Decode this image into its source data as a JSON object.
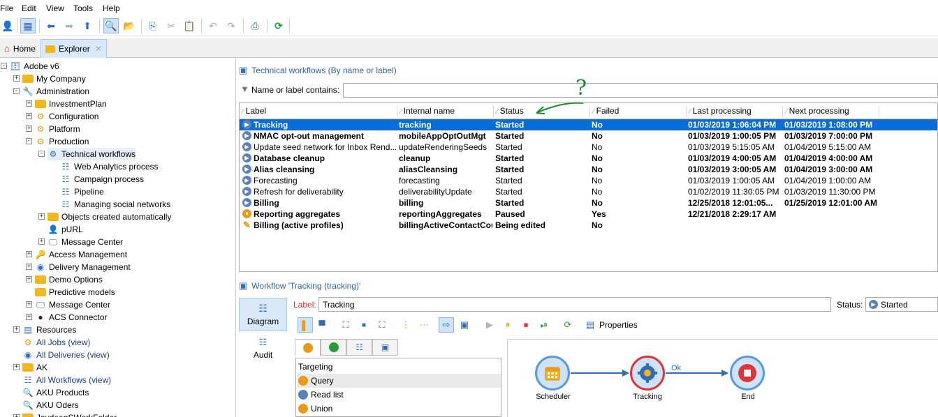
{
  "menu": [
    "File",
    "Edit",
    "View",
    "Tools",
    "Help"
  ],
  "tabs": [
    {
      "label": "Home"
    },
    {
      "label": "Explorer"
    }
  ],
  "tree": [
    {
      "label": "Adobe v6",
      "level": 0,
      "exp": "-",
      "icon": "database",
      "link": false
    },
    {
      "label": "My Company",
      "level": 1,
      "exp": "+",
      "icon": "folder",
      "link": false
    },
    {
      "label": "Administration",
      "level": 1,
      "exp": "-",
      "icon": "wrench",
      "link": false
    },
    {
      "label": "InvestmentPlan",
      "level": 2,
      "exp": "+",
      "icon": "folder",
      "link": false
    },
    {
      "label": "Configuration",
      "level": 2,
      "exp": "+",
      "icon": "gear",
      "link": false
    },
    {
      "label": "Platform",
      "level": 2,
      "exp": "+",
      "icon": "gear",
      "link": false
    },
    {
      "label": "Production",
      "level": 2,
      "exp": "-",
      "icon": "gear",
      "link": false
    },
    {
      "label": "Technical workflows",
      "level": 3,
      "exp": "-",
      "icon": "wf-folder",
      "link": false,
      "hl": true
    },
    {
      "label": "Web Analytics process",
      "level": 4,
      "exp": "",
      "icon": "workflow",
      "link": false
    },
    {
      "label": "Campaign process",
      "level": 4,
      "exp": "",
      "icon": "workflow",
      "link": false
    },
    {
      "label": "Pipeline",
      "level": 4,
      "exp": "",
      "icon": "workflow",
      "link": false
    },
    {
      "label": "Managing social networks",
      "level": 4,
      "exp": "",
      "icon": "workflow",
      "link": false
    },
    {
      "label": "Objects created automatically",
      "level": 3,
      "exp": "+",
      "icon": "folder",
      "link": false
    },
    {
      "label": "pURL",
      "level": 3,
      "exp": "",
      "icon": "purl",
      "link": false
    },
    {
      "label": "Message Center",
      "level": 3,
      "exp": "+",
      "icon": "monitor",
      "link": false
    },
    {
      "label": "Access Management",
      "level": 2,
      "exp": "+",
      "icon": "access",
      "link": false
    },
    {
      "label": "Delivery Management",
      "level": 2,
      "exp": "+",
      "icon": "delivery",
      "link": false
    },
    {
      "label": "Demo Options",
      "level": 2,
      "exp": "+",
      "icon": "folder",
      "link": false
    },
    {
      "label": "Predictive models",
      "level": 2,
      "exp": "",
      "icon": "folder",
      "link": false
    },
    {
      "label": "Message Center",
      "level": 2,
      "exp": "+",
      "icon": "monitor",
      "link": false
    },
    {
      "label": "ACS Connector",
      "level": 2,
      "exp": "+",
      "icon": "acs",
      "link": false
    },
    {
      "label": "Resources",
      "level": 1,
      "exp": "+",
      "icon": "resources",
      "link": false
    },
    {
      "label": "All Jobs (view)",
      "level": 1,
      "exp": "",
      "icon": "gear",
      "link": true
    },
    {
      "label": "All Deliveries (view)",
      "level": 1,
      "exp": "",
      "icon": "delivery",
      "link": true
    },
    {
      "label": "AK",
      "level": 1,
      "exp": "+",
      "icon": "folder",
      "link": false
    },
    {
      "label": "All Workflows (view)",
      "level": 1,
      "exp": "",
      "icon": "workflow",
      "link": true
    },
    {
      "label": "AKU Products",
      "level": 1,
      "exp": "",
      "icon": "search",
      "link": false
    },
    {
      "label": "AKU Oders",
      "level": 1,
      "exp": "",
      "icon": "search",
      "link": false
    },
    {
      "label": "JaydeepSWorkFolder",
      "level": 1,
      "exp": "+",
      "icon": "folder",
      "link": false
    }
  ],
  "list": {
    "title": "Technical workflows (By name or label)",
    "filter_label": "Name or label contains:",
    "filter_value": "",
    "columns": [
      "Label",
      "Internal name",
      "Status",
      "Failed",
      "Last processing",
      "Next processing"
    ],
    "rows": [
      {
        "label": "Tracking",
        "name": "tracking",
        "status": "Started",
        "failed": "No",
        "last": "01/03/2019 1:06:04 PM",
        "next": "01/03/2019 1:08:00 PM",
        "bold": true,
        "selected": true,
        "icon": "play"
      },
      {
        "label": "NMAC opt-out management",
        "name": "mobileAppOptOutMgt",
        "status": "Started",
        "failed": "No",
        "last": "01/03/2019 1:00:05 PM",
        "next": "01/03/2019 7:00:00 PM",
        "bold": true,
        "selected": false,
        "icon": "play"
      },
      {
        "label": "Update seed network for Inbox Rend...",
        "name": "updateRenderingSeeds",
        "status": "Started",
        "failed": "No",
        "last": "01/03/2019 5:15:05 AM",
        "next": "01/04/2019 5:15:00 AM",
        "bold": false,
        "selected": false,
        "icon": "play"
      },
      {
        "label": "Database cleanup",
        "name": "cleanup",
        "status": "Started",
        "failed": "No",
        "last": "01/03/2019 4:00:05 AM",
        "next": "01/04/2019 4:00:00 AM",
        "bold": true,
        "selected": false,
        "icon": "play"
      },
      {
        "label": "Alias cleansing",
        "name": "aliasCleansing",
        "status": "Started",
        "failed": "No",
        "last": "01/03/2019 3:00:05 AM",
        "next": "01/04/2019 3:00:00 AM",
        "bold": true,
        "selected": false,
        "icon": "play"
      },
      {
        "label": "Forecasting",
        "name": "forecasting",
        "status": "Started",
        "failed": "No",
        "last": "01/03/2019 1:00:05 AM",
        "next": "01/04/2019 1:00:00 AM",
        "bold": false,
        "selected": false,
        "icon": "play"
      },
      {
        "label": "Refresh for deliverability",
        "name": "deliverabilityUpdate",
        "status": "Started",
        "failed": "No",
        "last": "01/02/2019 11:30:05 PM",
        "next": "01/03/2019 11:30:00 PM",
        "bold": false,
        "selected": false,
        "icon": "play"
      },
      {
        "label": "Billing",
        "name": "billing",
        "status": "Started",
        "failed": "No",
        "last": "12/25/2018 12:01:05...",
        "next": "01/25/2019 12:01:00 AM",
        "bold": true,
        "selected": false,
        "icon": "play"
      },
      {
        "label": "Reporting aggregates",
        "name": "reportingAggregates",
        "status": "Paused",
        "failed": "Yes",
        "last": "12/21/2018 2:29:17 AM",
        "next": "",
        "bold": true,
        "selected": false,
        "icon": "pause"
      },
      {
        "label": "Billing (active profiles)",
        "name": "billingActiveContactCou...",
        "status": "Being edited",
        "failed": "No",
        "last": "",
        "next": "",
        "bold": true,
        "selected": false,
        "icon": "pencil"
      }
    ]
  },
  "annotation": {
    "text": "?"
  },
  "workflow": {
    "title": "Workflow 'Tracking (tracking)'",
    "label_caption": "Label:",
    "label_value": "Tracking",
    "status_caption": "Status:",
    "status_value": "Started",
    "side_diagram": "Diagram",
    "side_audit": "Audit",
    "properties": "Properties",
    "palette_header": "Targeting",
    "palette": [
      {
        "label": "Query",
        "color": "#e89a18",
        "selected": true
      },
      {
        "label": "Read list",
        "color": "#5a82b8",
        "selected": false
      },
      {
        "label": "Union",
        "color": "#e89a18",
        "selected": false
      }
    ],
    "nodes": [
      {
        "label": "Scheduler",
        "icon": "calendar-icon"
      },
      {
        "label": "Tracking",
        "icon": "gear-icon"
      },
      {
        "label": "End",
        "icon": "stop-icon"
      }
    ],
    "transition_label": "Ok"
  },
  "colors": {
    "accent": "#0a6cd6",
    "node_blue": "#5a9ad6",
    "node_red": "#e0343c",
    "annotation": "#1e8a2e"
  }
}
